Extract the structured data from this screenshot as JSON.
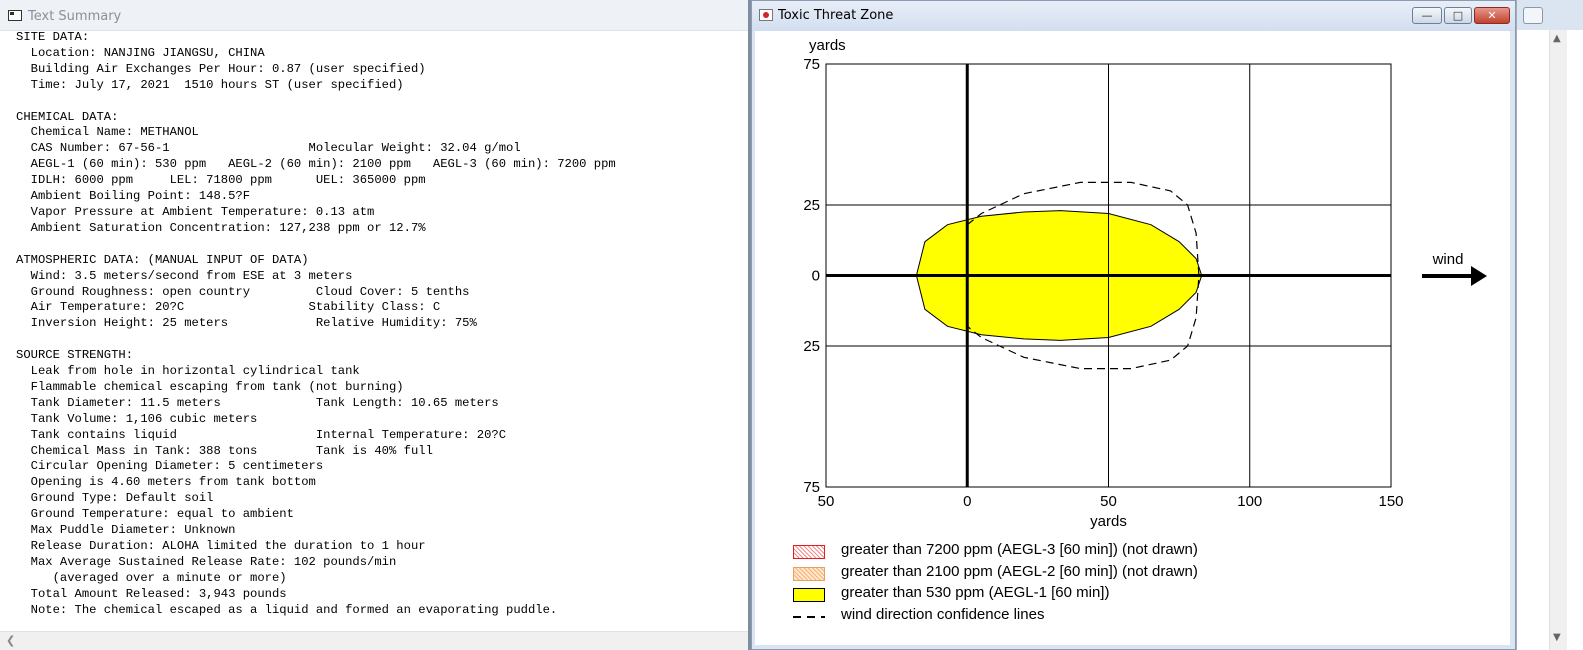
{
  "text_summary": {
    "title": "Text Summary",
    "icon": "window-icon",
    "lines": [
      "SITE DATA:",
      "  Location: NANJING JIANGSU, CHINA",
      "  Building Air Exchanges Per Hour: 0.87 (user specified)",
      "  Time: July 17, 2021  1510 hours ST (user specified)",
      "",
      "CHEMICAL DATA:",
      "  Chemical Name: METHANOL",
      "  CAS Number: 67-56-1                   Molecular Weight: 32.04 g/mol",
      "  AEGL-1 (60 min): 530 ppm   AEGL-2 (60 min): 2100 ppm   AEGL-3 (60 min): 7200 ppm",
      "  IDLH: 6000 ppm     LEL: 71800 ppm      UEL: 365000 ppm",
      "  Ambient Boiling Point: 148.5?F",
      "  Vapor Pressure at Ambient Temperature: 0.13 atm",
      "  Ambient Saturation Concentration: 127,238 ppm or 12.7%",
      "",
      "ATMOSPHERIC DATA: (MANUAL INPUT OF DATA)",
      "  Wind: 3.5 meters/second from ESE at 3 meters",
      "  Ground Roughness: open country         Cloud Cover: 5 tenths",
      "  Air Temperature: 20?C                 Stability Class: C",
      "  Inversion Height: 25 meters            Relative Humidity: 75%",
      "",
      "SOURCE STRENGTH:",
      "  Leak from hole in horizontal cylindrical tank",
      "  Flammable chemical escaping from tank (not burning)",
      "  Tank Diameter: 11.5 meters             Tank Length: 10.65 meters",
      "  Tank Volume: 1,106 cubic meters",
      "  Tank contains liquid                   Internal Temperature: 20?C",
      "  Chemical Mass in Tank: 388 tons        Tank is 40% full",
      "  Circular Opening Diameter: 5 centimeters",
      "  Opening is 4.60 meters from tank bottom",
      "  Ground Type: Default soil",
      "  Ground Temperature: equal to ambient",
      "  Max Puddle Diameter: Unknown",
      "  Release Duration: ALOHA limited the duration to 1 hour",
      "  Max Average Sustained Release Rate: 102 pounds/min",
      "     (averaged over a minute or more)",
      "  Total Amount Released: 3,943 pounds",
      "  Note: The chemical escaped as a liquid and formed an evaporating puddle."
    ]
  },
  "threat_zone": {
    "title": "Toxic Threat Zone",
    "icon": "app-red-dot-icon",
    "window_buttons": {
      "minimize": "—",
      "maximize": "□",
      "close": "✕"
    },
    "wind_label": "wind",
    "legend": [
      {
        "id": "aegl3",
        "label": "greater than 7200 ppm (AEGL-3 [60 min]) (not drawn)",
        "color": "#e02020"
      },
      {
        "id": "aegl2",
        "label": "greater than 2100 ppm (AEGL-2 [60 min]) (not drawn)",
        "color": "#f4b27a"
      },
      {
        "id": "aegl1",
        "label": "greater than 530 ppm (AEGL-1 [60 min])",
        "color": "#ffff00"
      },
      {
        "id": "conf",
        "label": "wind direction confidence lines",
        "color": "#000000"
      }
    ]
  },
  "chart_data": {
    "type": "area",
    "xlabel": "yards",
    "ylabel": "yards",
    "xlim": [
      -50,
      150
    ],
    "ylim": [
      -75,
      75
    ],
    "x_ticks": [
      -50,
      0,
      50,
      100,
      150
    ],
    "x_tick_labels": [
      "50",
      "0",
      "50",
      "100",
      "150"
    ],
    "y_ticks": [
      75,
      25,
      0,
      -25,
      -75
    ],
    "y_tick_labels": [
      "75",
      "25",
      "0",
      "25",
      "75"
    ],
    "grid": true,
    "series": [
      {
        "name": "greater than 530 ppm (AEGL-1 [60 min])",
        "kind": "filled_contour",
        "color": "#ffff00",
        "x": [
          -18,
          -15,
          -7,
          5,
          20,
          33,
          50,
          65,
          75,
          81,
          83,
          81,
          75,
          65,
          50,
          33,
          20,
          5,
          -7,
          -15,
          -18
        ],
        "y": [
          0,
          12,
          18,
          21,
          22.5,
          23,
          22,
          18,
          12,
          6,
          0,
          -6,
          -12,
          -18,
          -22,
          -23,
          -22.5,
          -21,
          -18,
          -12,
          0
        ]
      },
      {
        "name": "wind direction confidence lines",
        "kind": "dashed_line",
        "color": "#000000",
        "x": [
          0,
          5,
          20,
          40,
          58,
          72,
          78,
          81,
          82,
          81,
          78,
          72,
          58,
          40,
          20,
          5,
          0
        ],
        "y": [
          18,
          22,
          29,
          33,
          33,
          30,
          25,
          15,
          0,
          -15,
          -25,
          -30,
          -33,
          -33,
          -29,
          -22,
          -18
        ]
      }
    ]
  }
}
